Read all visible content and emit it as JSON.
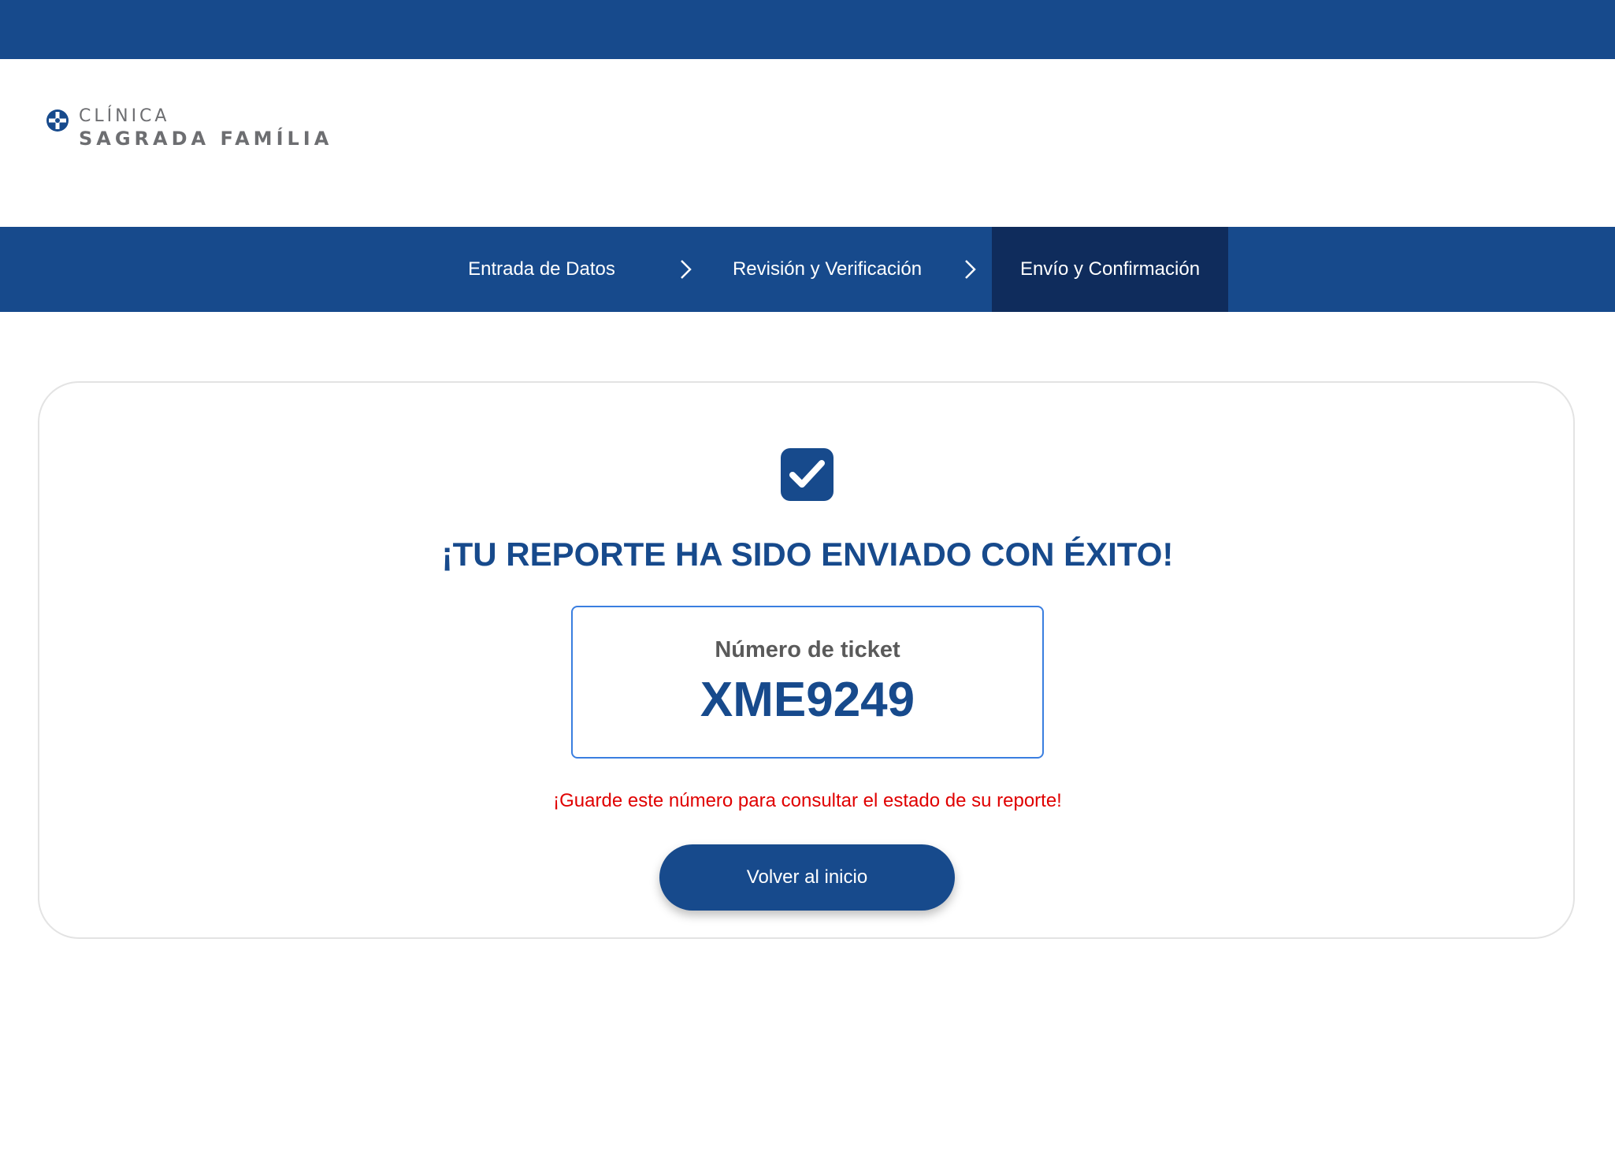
{
  "header": {
    "logo": {
      "line1": "CLÍNICA",
      "line2": "SAGRADA FAMÍLIA",
      "icon": "cross-circle-icon",
      "color": "#6d6e71",
      "icon_color": "#174a8c"
    }
  },
  "steps": {
    "items": [
      {
        "label": "Entrada de Datos",
        "active": false
      },
      {
        "label": "Revisión y Verificación",
        "active": false
      },
      {
        "label": "Envío y Confirmación",
        "active": true
      }
    ],
    "separator_icon": "chevron-right-icon",
    "bar_color": "#174a8c",
    "active_color": "#0f2c5c"
  },
  "confirmation": {
    "icon": "checkbox-checked-icon",
    "title": "¡TU REPORTE HA SIDO ENVIADO CON ÉXITO!",
    "ticket_label": "Número de ticket",
    "ticket_number": "XME9249",
    "warning": "¡Guarde este número para consultar el estado de su reporte!",
    "warning_color": "#e00000",
    "button_label": "Volver al inicio"
  }
}
